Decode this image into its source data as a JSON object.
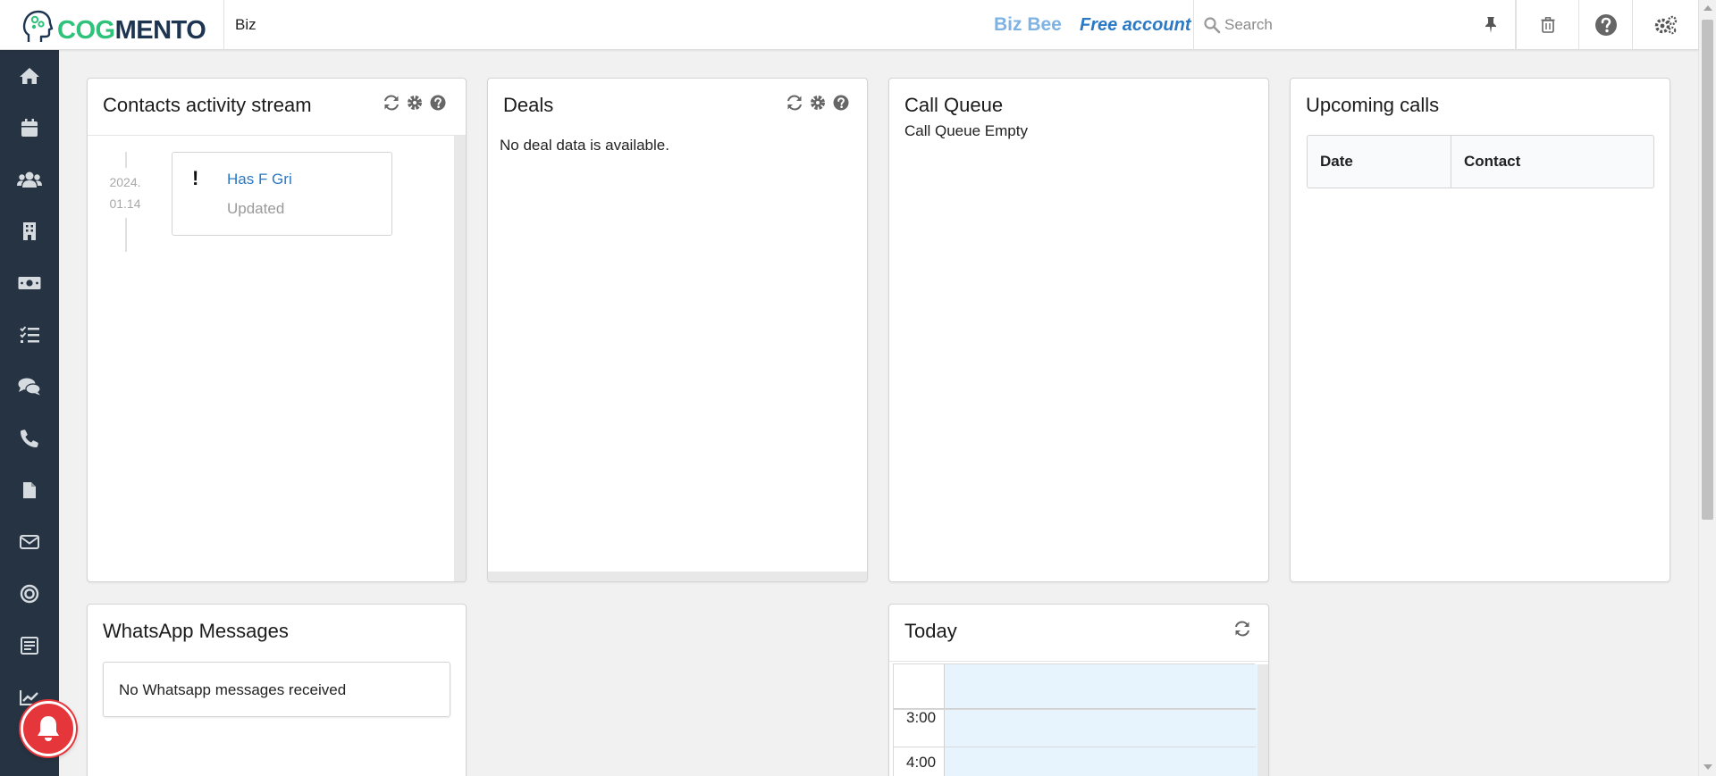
{
  "app": {
    "brand_part1": "COG",
    "brand_part2": "MENTO",
    "workspace": "Biz",
    "user_name": "Biz Bee",
    "plan": "Free account",
    "search_placeholder": "Search"
  },
  "colors": {
    "brand_green": "#2fc27a",
    "brand_navy": "#1d3550",
    "sidebar_bg": "#263342",
    "link_blue": "#2b79c4",
    "alert_red": "#e5363b",
    "calendar_bg": "#e8f4fd"
  },
  "topbar_icons": [
    "pin-icon",
    "trash-icon",
    "help-icon",
    "settings-icon"
  ],
  "sidebar_icons": [
    "home-icon",
    "calendar-icon",
    "contacts-icon",
    "companies-icon",
    "deals-icon",
    "tasks-icon",
    "cases-icon",
    "calls-icon",
    "documents-icon",
    "email-icon",
    "campaigns-icon",
    "forms-icon",
    "reports-icon"
  ],
  "cards": {
    "activity": {
      "title": "Contacts activity stream",
      "event": {
        "date_line1": "2024.",
        "date_line2": "01.14",
        "marker": "!",
        "contact": "Has F Gri",
        "status": "Updated"
      }
    },
    "deals": {
      "title": "Deals",
      "message": "No deal data is available."
    },
    "call_queue": {
      "title": "Call Queue",
      "message": "Call Queue Empty"
    },
    "upcoming_calls": {
      "title": "Upcoming calls",
      "columns": [
        "Date",
        "Contact"
      ]
    },
    "whatsapp": {
      "title": "WhatsApp Messages",
      "message": "No Whatsapp messages received"
    },
    "today": {
      "title": "Today",
      "times": [
        "3:00",
        "4:00"
      ]
    }
  }
}
